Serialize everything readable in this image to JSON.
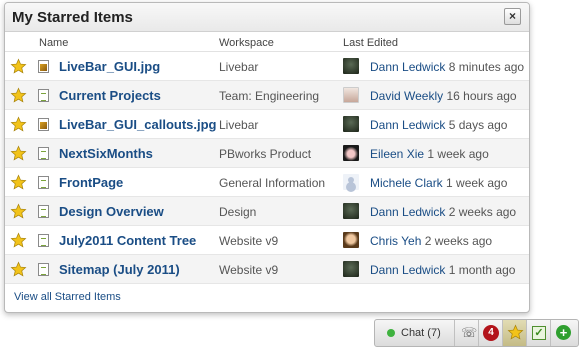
{
  "panel": {
    "title": "My Starred Items",
    "close_label": "×",
    "columns": {
      "name": "Name",
      "workspace": "Workspace",
      "last_edited": "Last Edited"
    },
    "items": [
      {
        "name": "LiveBar_GUI.jpg",
        "type": "image",
        "workspace": "Livebar",
        "editor": "Dann Ledwick",
        "when": "8 minutes ago",
        "avatar": "dark"
      },
      {
        "name": "Current Projects",
        "type": "doc",
        "workspace": "Team: Engineering",
        "editor": "David Weekly",
        "when": "16 hours ago",
        "avatar": "david"
      },
      {
        "name": "LiveBar_GUI_callouts.jpg",
        "type": "image",
        "workspace": "Livebar",
        "editor": "Dann Ledwick",
        "when": "5 days ago",
        "avatar": "dark"
      },
      {
        "name": "NextSixMonths",
        "type": "doc",
        "workspace": "PBworks Product",
        "editor": "Eileen Xie",
        "when": "1 week ago",
        "avatar": "eileen"
      },
      {
        "name": "FrontPage",
        "type": "doc",
        "workspace": "General Information",
        "editor": "Michele Clark",
        "when": "1 week ago",
        "avatar": "michele"
      },
      {
        "name": "Design Overview",
        "type": "doc",
        "workspace": "Design",
        "editor": "Dann Ledwick",
        "when": "2 weeks ago",
        "avatar": "dark"
      },
      {
        "name": "July2011 Content Tree",
        "type": "doc",
        "workspace": "Website v9",
        "editor": "Chris Yeh",
        "when": "2 weeks ago",
        "avatar": "chris"
      },
      {
        "name": "Sitemap (July 2011)",
        "type": "doc",
        "workspace": "Website v9",
        "editor": "Dann Ledwick",
        "when": "1 month ago",
        "avatar": "dark"
      }
    ],
    "view_all": "View all Starred Items"
  },
  "livebar": {
    "chat_label": "Chat (7)",
    "notification_count": "4",
    "check_symbol": "✓",
    "plus_symbol": "+",
    "phone_symbol": "☏"
  },
  "colors": {
    "link": "#1a4d85",
    "star": "#f2c31a",
    "badge": "#b3141b",
    "online": "#3fb23f"
  }
}
